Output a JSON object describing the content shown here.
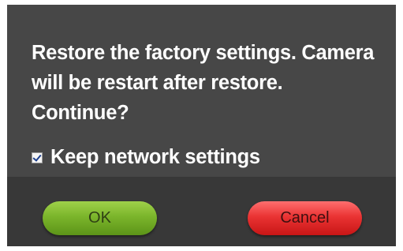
{
  "dialog": {
    "message": "Restore the factory settings. Camera will be restart after restore. Continue?",
    "keep_network": {
      "label": "Keep network settings",
      "checked": true
    },
    "buttons": {
      "ok_label": "OK",
      "cancel_label": "Cancel"
    },
    "colors": {
      "ok": "#7bb52b",
      "cancel": "#ea3333",
      "background": "#474747"
    }
  }
}
